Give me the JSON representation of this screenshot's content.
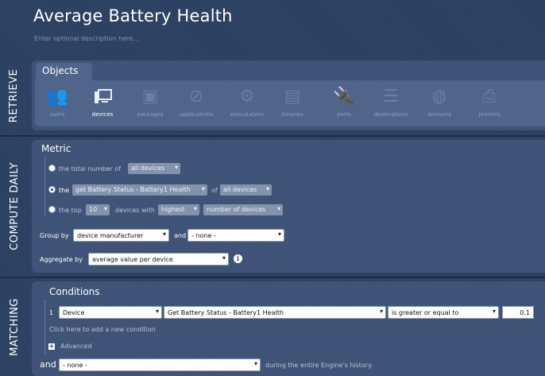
{
  "header": {
    "title": "Average Battery Health",
    "description_placeholder": "Enter optional description here..."
  },
  "sections": {
    "retrieve": "RETRIEVE",
    "compute": "COMPUTE DAILY",
    "matching": "MATCHING"
  },
  "objects": {
    "tab_label": "Objects",
    "items": [
      {
        "label": "users",
        "icon": "users-icon",
        "active": false
      },
      {
        "label": "devices",
        "icon": "devices-icon",
        "active": true
      },
      {
        "label": "packages",
        "icon": "packages-icon",
        "active": false
      },
      {
        "label": "applications",
        "icon": "applications-icon",
        "active": false
      },
      {
        "label": "executables",
        "icon": "executables-icon",
        "active": false
      },
      {
        "label": "binaries",
        "icon": "binaries-icon",
        "active": false
      },
      {
        "label": "ports",
        "icon": "ports-icon",
        "active": false
      },
      {
        "label": "destinations",
        "icon": "destinations-icon",
        "active": false
      },
      {
        "label": "domains",
        "icon": "domains-icon",
        "active": false
      },
      {
        "label": "printers",
        "icon": "printers-icon",
        "active": false
      }
    ]
  },
  "metric": {
    "title": "Metric",
    "row1": {
      "prefix": "the total number of",
      "scope": "all devices"
    },
    "row2": {
      "prefix": "the",
      "field": "get Battery Status - Battery1 Health",
      "of": "of",
      "scope": "all devices"
    },
    "row3": {
      "prefix": "the top",
      "count": "10",
      "middle": "devices with",
      "order": "highest",
      "measure": "number of devices"
    },
    "group_by_label": "Group by",
    "group_by_value": "device manufacturer",
    "and_label": "and",
    "group_by_second": "- none -",
    "aggregate_label": "Aggregate by",
    "aggregate_value": "average value per device",
    "info_glyph": "i"
  },
  "conditions": {
    "title": "Conditions",
    "row_index": "1",
    "object": "Device",
    "field": "Get Battery Status - Battery1 Health",
    "operator": "is greater or equal to",
    "value": "0.1",
    "add_link": "Click here to add a new condition",
    "advanced_label": "Advanced",
    "advanced_glyph": "+",
    "and_label": "and",
    "and_value": "- none -",
    "suffix": "during the entire Engine's history."
  },
  "colors": {
    "background": "#2b3f61",
    "panel": "#3d5276",
    "objects_strip": "#4f6589"
  }
}
